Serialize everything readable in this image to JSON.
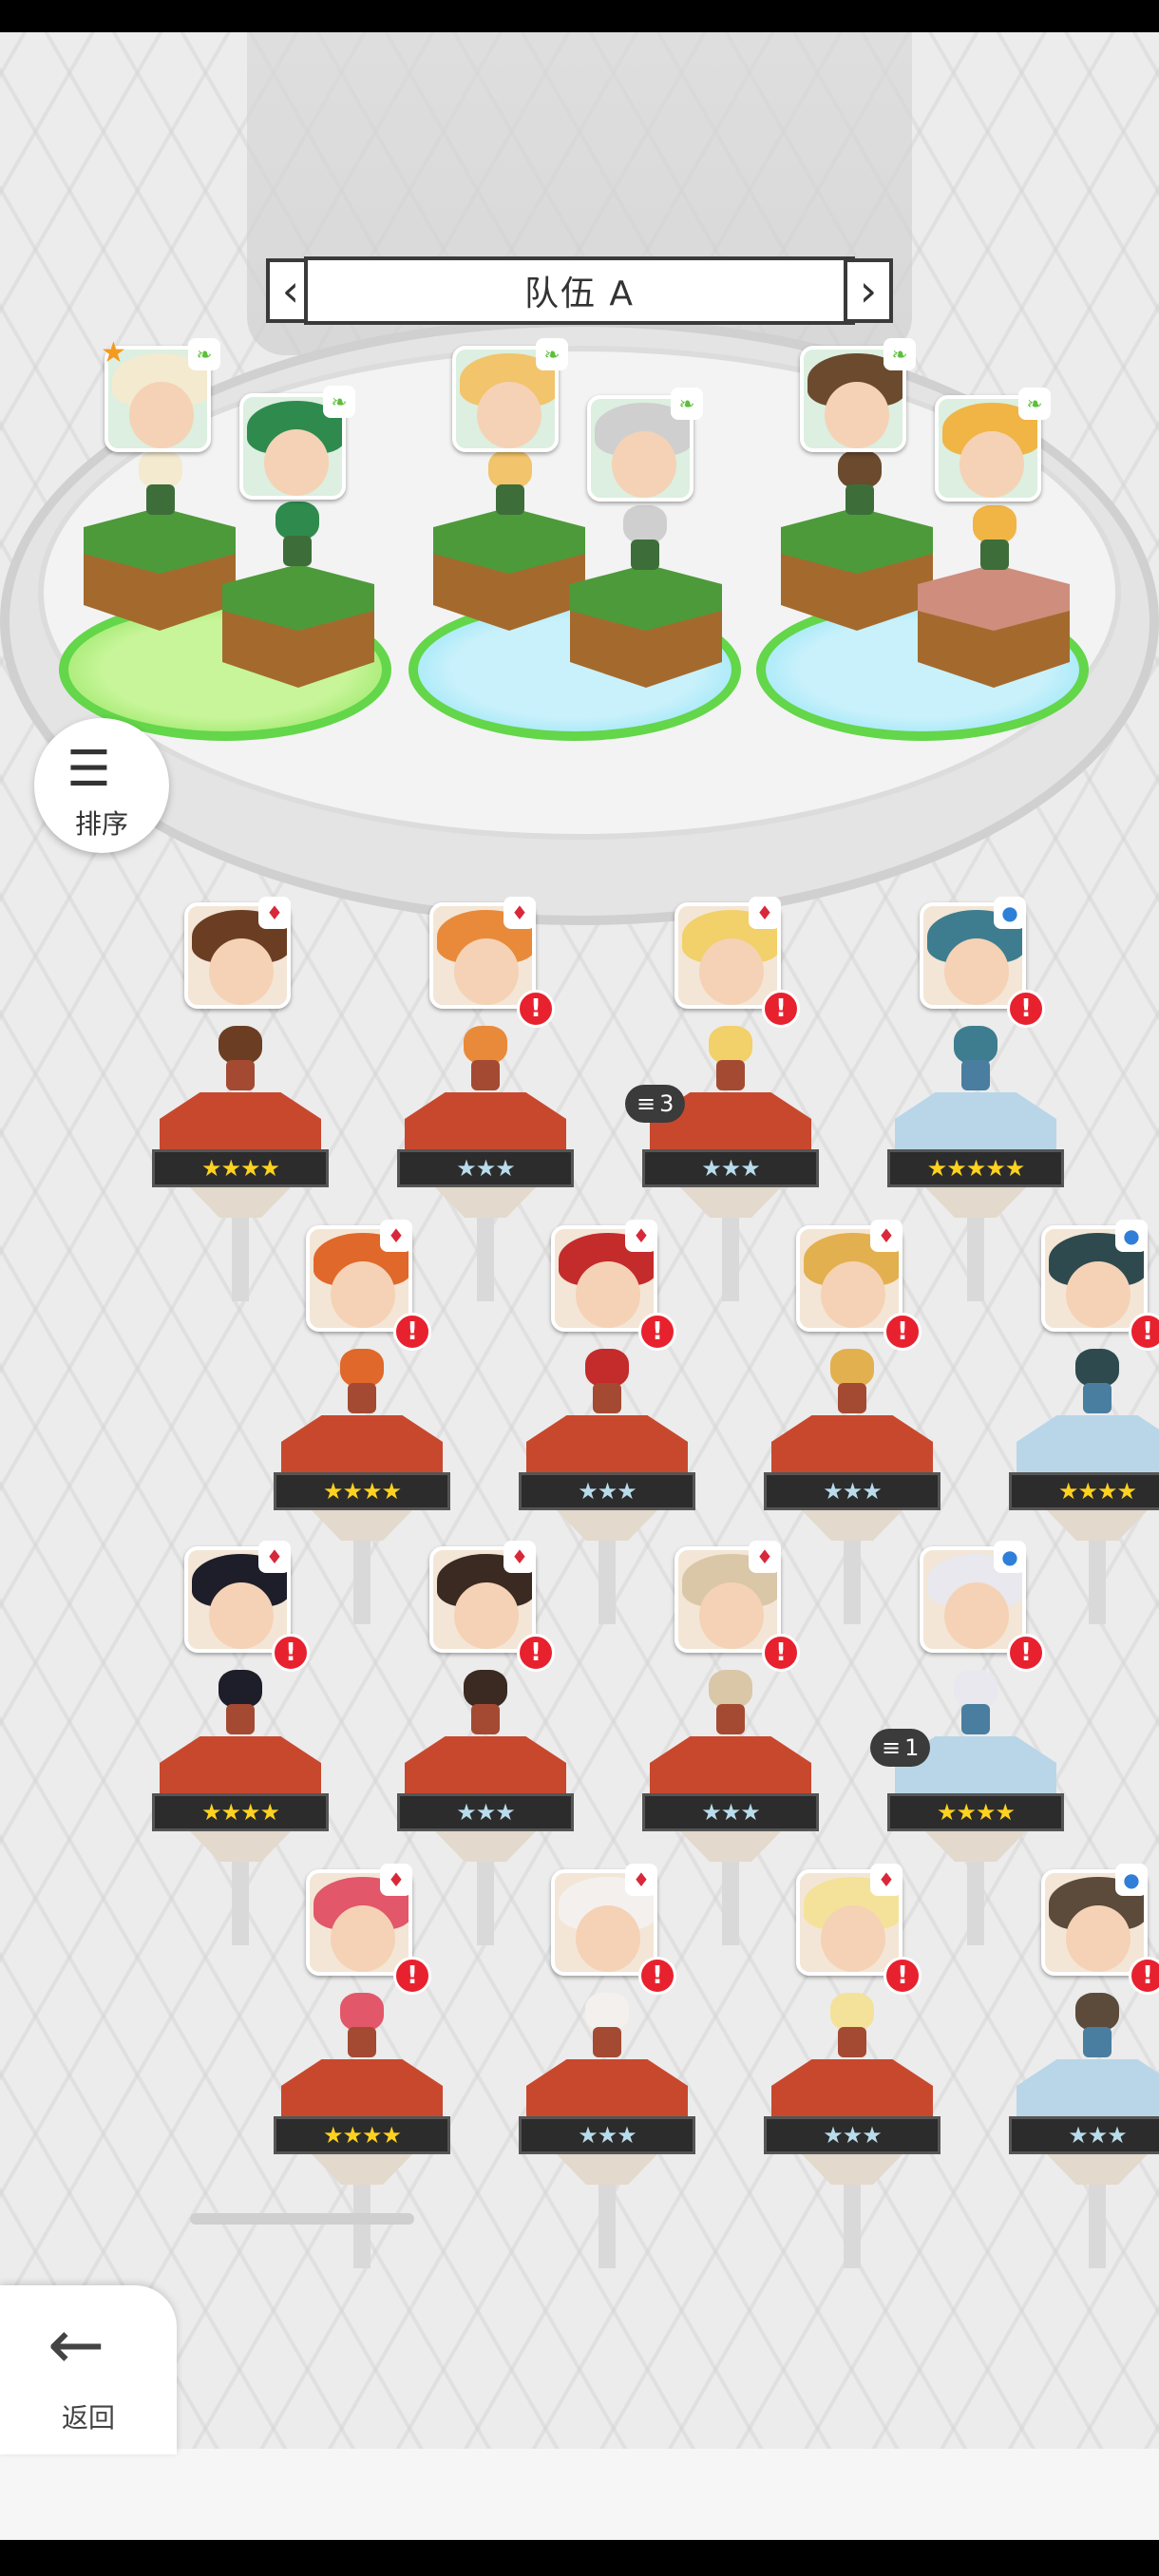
{
  "team": {
    "title": "队伍 A",
    "prev_icon": "chevron-left-icon",
    "next_icon": "chevron-right-icon"
  },
  "team_slots": [
    {
      "element": "nature",
      "favorite": true,
      "hair": "#f3ead0",
      "block": "green"
    },
    {
      "element": "nature",
      "favorite": false,
      "hair": "#2f8a4e",
      "block": "green"
    },
    {
      "element": "nature",
      "favorite": false,
      "hair": "#f2c46b",
      "block": "green"
    },
    {
      "element": "nature",
      "favorite": false,
      "hair": "#cfcfcf",
      "block": "green"
    },
    {
      "element": "nature",
      "favorite": false,
      "hair": "#6b4a2e",
      "block": "green"
    },
    {
      "element": "nature",
      "favorite": false,
      "hair": "#f0b545",
      "block": "pink"
    }
  ],
  "roster": [
    {
      "element": "fire",
      "stars": "★★★★",
      "tier": "gold",
      "alert": false,
      "hair": "#6b3e24",
      "pedestal": "red"
    },
    {
      "element": "fire",
      "stars": "★★★",
      "tier": "silver",
      "alert": true,
      "hair": "#e98a3a",
      "pedestal": "red"
    },
    {
      "element": "fire",
      "stars": "★★★",
      "tier": "silver",
      "alert": true,
      "hair": "#f2d06a",
      "pedestal": "red",
      "stack": "3"
    },
    {
      "element": "water",
      "stars": "★★★★★",
      "tier": "gold",
      "alert": true,
      "hair": "#3e7d8f",
      "pedestal": "blue"
    },
    {
      "element": "fire",
      "stars": "★★★★",
      "tier": "gold",
      "alert": true,
      "hair": "#e0682a",
      "pedestal": "red"
    },
    {
      "element": "fire",
      "stars": "★★★",
      "tier": "silver",
      "alert": true,
      "hair": "#c42b2b",
      "pedestal": "red"
    },
    {
      "element": "fire",
      "stars": "★★★",
      "tier": "silver",
      "alert": true,
      "hair": "#e3b04f",
      "pedestal": "red"
    },
    {
      "element": "water",
      "stars": "★★★★",
      "tier": "gold",
      "alert": true,
      "hair": "#2e4a4f",
      "pedestal": "blue"
    },
    {
      "element": "fire",
      "stars": "★★★★",
      "tier": "gold",
      "alert": true,
      "hair": "#1e1e2a",
      "pedestal": "red"
    },
    {
      "element": "fire",
      "stars": "★★★",
      "tier": "silver",
      "alert": true,
      "hair": "#3a2a22",
      "pedestal": "red"
    },
    {
      "element": "fire",
      "stars": "★★★",
      "tier": "silver",
      "alert": true,
      "hair": "#d9c7a8",
      "pedestal": "red"
    },
    {
      "element": "water",
      "stars": "★★★★",
      "tier": "gold",
      "alert": true,
      "hair": "#e8e8ee",
      "pedestal": "blue",
      "stack": "1"
    },
    {
      "element": "fire",
      "stars": "★★★★",
      "tier": "gold",
      "alert": true,
      "hair": "#e2576a",
      "pedestal": "red"
    },
    {
      "element": "fire",
      "stars": "★★★",
      "tier": "silver",
      "alert": true,
      "hair": "#f4f0ee",
      "pedestal": "red"
    },
    {
      "element": "fire",
      "stars": "★★★",
      "tier": "silver",
      "alert": true,
      "hair": "#f4e29a",
      "pedestal": "red"
    },
    {
      "element": "water",
      "stars": "★★★",
      "tier": "silver",
      "alert": true,
      "hair": "#5c4a3a",
      "pedestal": "blue"
    }
  ],
  "buttons": {
    "sort_label": "排序",
    "sort_icon": "sort-descending-icon",
    "back_label": "返回",
    "back_icon": "arrow-left-icon"
  },
  "icons": {
    "alert": "!",
    "nature": "leaf-icon",
    "fire": "flame-icon",
    "water": "water-drop-icon",
    "stack": "stack-icon"
  },
  "colors": {
    "alert_red": "#e8212f",
    "nature_green": "#63d64a",
    "fire_red": "#c8482e",
    "gold_star": "#ffd21f",
    "silver_star": "#b9dcec"
  }
}
